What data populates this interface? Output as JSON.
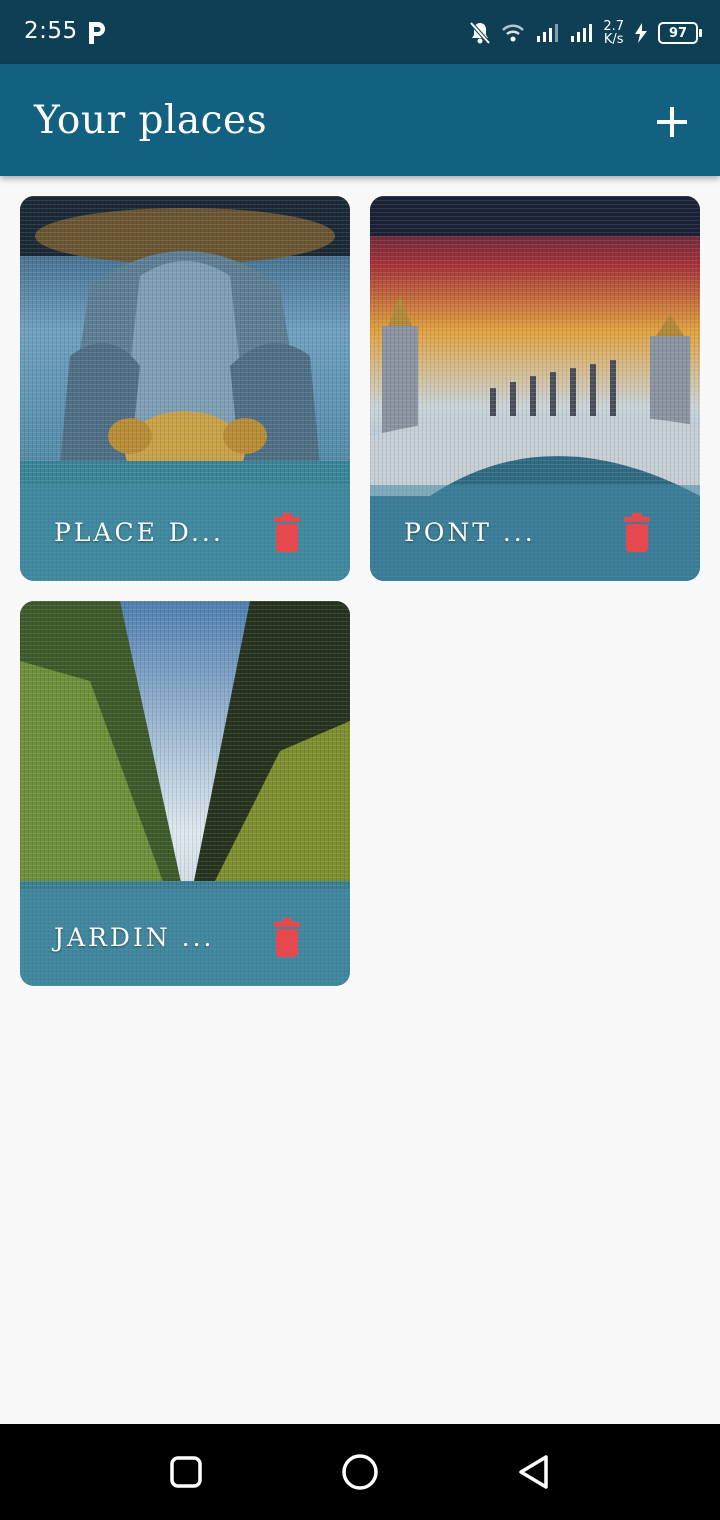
{
  "status_bar": {
    "time": "2:55",
    "speed_top": "2.7",
    "speed_bottom": "K/s",
    "battery": "97"
  },
  "app_bar": {
    "title": "Your places"
  },
  "places": [
    {
      "label": "PLACE D...",
      "image": "fountain-photo"
    },
    {
      "label": "PONT ...",
      "image": "bridge-photo"
    },
    {
      "label": "JARDIN ...",
      "image": "garden-photo"
    }
  ],
  "colors": {
    "status_bar": "#0f3f55",
    "app_bar": "#136180",
    "background": "#f8f8f8",
    "delete": "#e5484d"
  }
}
